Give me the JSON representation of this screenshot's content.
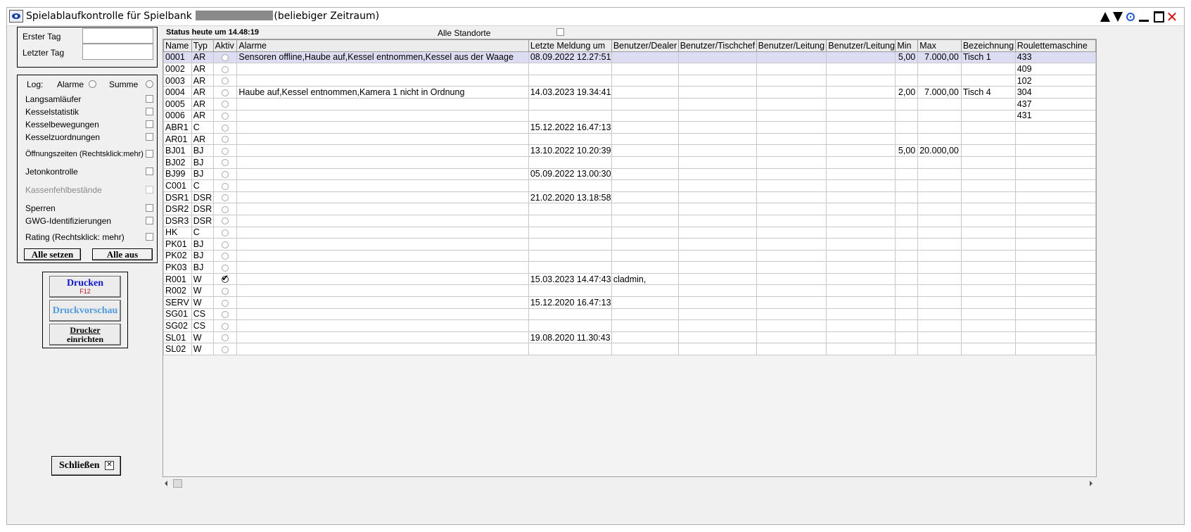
{
  "window": {
    "title_prefix": "Spielablaufkontrolle  für Spielbank",
    "title_suffix": "(beliebiger Zeitraum)"
  },
  "dates": {
    "first_label": "Erster Tag",
    "first_value": "",
    "last_label": "Letzter Tag",
    "last_value": ""
  },
  "log": {
    "label": "Log:",
    "alarms_label": "Alarme",
    "sum_label": "Summe",
    "options": [
      "Langsamläufer",
      "Kesselstatistik",
      "Kesselbewegungen",
      "Kesselzuordnungen",
      "Öffnungszeiten (Rechtsklick:mehr)",
      "Jetonkontrolle",
      "Kassenfehlbestände",
      "Sperren",
      "GWG-Identifizierungen",
      "Rating (Rechtsklick: mehr)"
    ],
    "set_all_label": "Alle setzen",
    "all_off_label": "Alle aus"
  },
  "print": {
    "print_label": "Drucken",
    "print_shortcut": "F12",
    "preview_label": "Druckvorschau",
    "setup_label_1": "Drucker",
    "setup_label_2": "einrichten"
  },
  "close_label": "Schließen",
  "status_text": "Status heute um 14.48:19",
  "all_locations_label": "Alle Standorte",
  "columns": [
    "Name",
    "Typ",
    "Aktiv",
    "Alarme",
    "Letzte Meldung um",
    "Benutzer/Dealer",
    "Benutzer/Tischchef",
    "Benutzer/Leitung",
    "Benutzer/Leitung",
    "Min",
    "Max",
    "Bezeichnung",
    "Roulettemaschine"
  ],
  "rows": [
    [
      "0001",
      "AR",
      "",
      "Sensoren offline,Haube auf,Kessel entnommen,Kessel aus der Waage",
      "08.09.2022  12.27:51",
      "",
      "",
      "",
      "",
      "5,00",
      "7.000,00",
      "Tisch 1",
      "433"
    ],
    [
      "0002",
      "AR",
      "",
      "",
      "",
      "",
      "",
      "",
      "",
      "",
      "",
      "",
      "409"
    ],
    [
      "0003",
      "AR",
      "",
      "",
      "",
      "",
      "",
      "",
      "",
      "",
      "",
      "",
      "102"
    ],
    [
      "0004",
      "AR",
      "",
      "Haube auf,Kessel entnommen,Kamera 1 nicht in Ordnung",
      "14.03.2023  19.34:41",
      "",
      "",
      "",
      "",
      "2,00",
      "7.000,00",
      "Tisch 4",
      "304"
    ],
    [
      "0005",
      "AR",
      "",
      "",
      "",
      "",
      "",
      "",
      "",
      "",
      "",
      "",
      "437"
    ],
    [
      "0006",
      "AR",
      "",
      "",
      "",
      "",
      "",
      "",
      "",
      "",
      "",
      "",
      "431"
    ],
    [
      "ABR1",
      "C",
      "",
      "",
      "15.12.2022  16.47:13",
      "",
      "",
      "",
      "",
      "",
      "",
      "",
      ""
    ],
    [
      "AR01",
      "AR",
      "",
      "",
      "",
      "",
      "",
      "",
      "",
      "",
      "",
      "",
      ""
    ],
    [
      "BJ01",
      "BJ",
      "",
      "",
      "13.10.2022  10.20:39",
      "",
      "",
      "",
      "",
      "5,00",
      "20.000,00",
      "",
      ""
    ],
    [
      "BJ02",
      "BJ",
      "",
      "",
      "",
      "",
      "",
      "",
      "",
      "",
      "",
      "",
      ""
    ],
    [
      "BJ99",
      "BJ",
      "",
      "",
      "05.09.2022  13.00:30",
      "",
      "",
      "",
      "",
      "",
      "",
      "",
      ""
    ],
    [
      "C001",
      "C",
      "",
      "",
      "",
      "",
      "",
      "",
      "",
      "",
      "",
      "",
      ""
    ],
    [
      "DSR1",
      "DSR",
      "",
      "",
      "21.02.2020  13.18:58",
      "",
      "",
      "",
      "",
      "",
      "",
      "",
      ""
    ],
    [
      "DSR2",
      "DSR",
      "",
      "",
      "",
      "",
      "",
      "",
      "",
      "",
      "",
      "",
      ""
    ],
    [
      "DSR3",
      "DSR",
      "",
      "",
      "",
      "",
      "",
      "",
      "",
      "",
      "",
      "",
      ""
    ],
    [
      "HK",
      "C",
      "",
      "",
      "",
      "",
      "",
      "",
      "",
      "",
      "",
      "",
      ""
    ],
    [
      "PK01",
      "BJ",
      "",
      "",
      "",
      "",
      "",
      "",
      "",
      "",
      "",
      "",
      ""
    ],
    [
      "PK02",
      "BJ",
      "",
      "",
      "",
      "",
      "",
      "",
      "",
      "",
      "",
      "",
      ""
    ],
    [
      "PK03",
      "BJ",
      "",
      "",
      "",
      "",
      "",
      "",
      "",
      "",
      "",
      "",
      ""
    ],
    [
      "R001",
      "W",
      "",
      "",
      "15.03.2023  14.47:43",
      "cladmin,",
      "",
      "",
      "",
      "",
      "",
      "",
      ""
    ],
    [
      "R002",
      "W",
      "",
      "",
      "",
      "",
      "",
      "",
      "",
      "",
      "",
      "",
      ""
    ],
    [
      "SERV",
      "W",
      "",
      "",
      "15.12.2020  16.47:13",
      "",
      "",
      "",
      "",
      "",
      "",
      "",
      ""
    ],
    [
      "SG01",
      "CS",
      "",
      "",
      "",
      "",
      "",
      "",
      "",
      "",
      "",
      "",
      ""
    ],
    [
      "SG02",
      "CS",
      "",
      "",
      "",
      "",
      "",
      "",
      "",
      "",
      "",
      "",
      ""
    ],
    [
      "SL01",
      "W",
      "",
      "",
      "19.08.2020  11.30:43",
      "",
      "",
      "",
      "",
      "",
      "",
      "",
      ""
    ],
    [
      "SL02",
      "W",
      "",
      "",
      "",
      "",
      "",
      "",
      "",
      "",
      "",
      "",
      ""
    ]
  ],
  "active_rows": [
    19
  ],
  "selected_row": 0
}
